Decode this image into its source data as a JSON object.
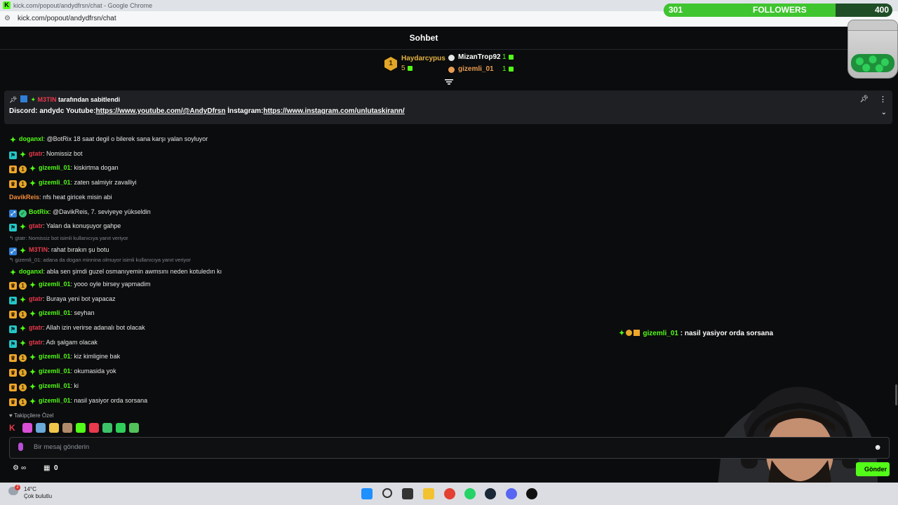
{
  "browser": {
    "window_title": "kick.com/popout/andydfrsn/chat - Google Chrome",
    "url": "kick.com/popout/andydfrsn/chat"
  },
  "follower_goal": {
    "current": "301",
    "label": "FOLLOWERS",
    "target": "400",
    "progress_fraction": 0.75
  },
  "chat": {
    "title": "Sohbet",
    "leaderboard": [
      {
        "rank": "1",
        "name": "Haydarcypus",
        "count": "5"
      },
      {
        "name": "MizanTrop92",
        "count": "1"
      },
      {
        "name": "gizemli_01",
        "count": "1"
      }
    ],
    "pinned": {
      "pinned_by_user": "M3TIN",
      "pinned_by_suffix": "tarafından sabitlendi",
      "text_prefix": "Discord: andydc Youtube:",
      "youtube_link": "https://www.youtube.com/@AndyDfrsn",
      "instagram_label": " İnstagram:",
      "instagram_link": "https://www.instagram.com/unlutaskirann/"
    },
    "messages": [
      {
        "badges": [
          "star"
        ],
        "user": "doganxl",
        "user_color": "#53fc18",
        "text": "@BotRix 18 saat degil o bilerek sana karşı yalan soyluyor"
      },
      {
        "badges": [
          "mod",
          "star"
        ],
        "user": "gtatr",
        "user_color": "#e8394d",
        "text": "Nomissiz bot"
      },
      {
        "badges": [
          "crown",
          "one",
          "star"
        ],
        "user": "gizemli_01",
        "user_color": "#53fc18",
        "text": "kiskirtma dogan"
      },
      {
        "badges": [
          "crown",
          "one",
          "star"
        ],
        "user": "gizemli_01",
        "user_color": "#53fc18",
        "text": "zaten salmiyir zavalliyi"
      },
      {
        "badges": [],
        "user": "DavikReis",
        "user_color": "#f58b3a",
        "text": "nfs heat giricek misin abi"
      },
      {
        "badges": [
          "vip",
          "bot"
        ],
        "user": "BotRix",
        "user_color": "#53fc18",
        "text": "@DavikReis, 7. seviyeye yükseldin"
      },
      {
        "badges": [
          "mod",
          "star"
        ],
        "user": "gtatr",
        "user_color": "#e8394d",
        "text": "Yalan da konuşuyor gahpe"
      },
      {
        "reply": "gtatr: Nomissiz bot isimli kullanıcıya yanıt veriyor",
        "badges": [
          "vip",
          "star"
        ],
        "user": "M3TIN",
        "user_color": "#e8394d",
        "text": "rahat bırakın şu botu"
      },
      {
        "reply": "gizemli_01: adana da dogan minnina olmuyor isimli kullanıcıya yanıt veriyor",
        "badges": [
          "star"
        ],
        "user": "doganxl",
        "user_color": "#53fc18",
        "text": "abla sen şimdi guzel osmanıyemin awmsını neden kotuledın kı"
      },
      {
        "badges": [
          "crown",
          "one",
          "star"
        ],
        "user": "gizemli_01",
        "user_color": "#53fc18",
        "text": "yooo oyle birsey yapmadim"
      },
      {
        "badges": [
          "mod",
          "star"
        ],
        "user": "gtatr",
        "user_color": "#e8394d",
        "text": "Buraya yeni bot yapacaz"
      },
      {
        "badges": [
          "crown",
          "one",
          "star"
        ],
        "user": "gizemli_01",
        "user_color": "#53fc18",
        "text": "seyhan"
      },
      {
        "badges": [
          "mod",
          "star"
        ],
        "user": "gtatr",
        "user_color": "#e8394d",
        "text": "Allah izin verirse adanalı bot olacak"
      },
      {
        "badges": [
          "mod",
          "star"
        ],
        "user": "gtatr",
        "user_color": "#e8394d",
        "text": "Adı şalgam olacak"
      },
      {
        "badges": [
          "crown",
          "one",
          "star"
        ],
        "user": "gizemli_01",
        "user_color": "#53fc18",
        "text": "kiz kimligine bak"
      },
      {
        "badges": [
          "crown",
          "one",
          "star"
        ],
        "user": "gizemli_01",
        "user_color": "#53fc18",
        "text": "okumasida yok"
      },
      {
        "badges": [
          "crown",
          "one",
          "star"
        ],
        "user": "gizemli_01",
        "user_color": "#53fc18",
        "text": "ki"
      },
      {
        "badges": [
          "crown",
          "one",
          "star"
        ],
        "user": "gizemli_01",
        "user_color": "#53fc18",
        "text": "nasil yasiyor orda sorsana"
      }
    ],
    "overlay_message": {
      "user": "gizemli_01",
      "text": " : nasil yasiyor orda sorsana"
    },
    "followers_only_label": "Takipçilere Özel",
    "emotes": [
      "kick-logo-emote",
      "candy-emote",
      "gamer-emote",
      "face-emote",
      "figure-emote",
      "green-face-emote",
      "red-face-emote",
      "skull-emote",
      "chat-emote",
      "alien-emote"
    ],
    "input_placeholder": "Bir mesaj gönderin",
    "footer": {
      "points_icon": "∞",
      "count": "0"
    },
    "send_label": "Gönder"
  },
  "taskbar": {
    "weather_temp": "14°C",
    "weather_desc": "Çok bulutlu",
    "weather_badge": "2"
  },
  "colors": {
    "kick_green": "#53fc18",
    "background": "#0b0c0d",
    "gold": "#e3a628"
  }
}
